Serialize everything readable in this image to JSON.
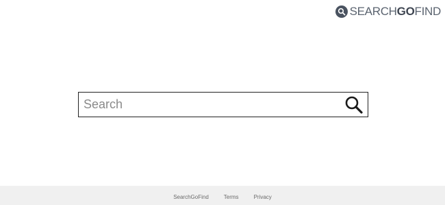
{
  "header": {
    "logo": {
      "text_regular_1": "SEARCH",
      "text_bold": "GO",
      "text_regular_2": "FIND",
      "icon": "magnifier-icon",
      "badge_color": "#4a5360"
    }
  },
  "search": {
    "placeholder": "Search",
    "value": "",
    "button_icon": "search-icon"
  },
  "footer": {
    "links": [
      "SearchGoFind",
      "Terms",
      "Privacy"
    ],
    "background": "#f0f0f0"
  }
}
